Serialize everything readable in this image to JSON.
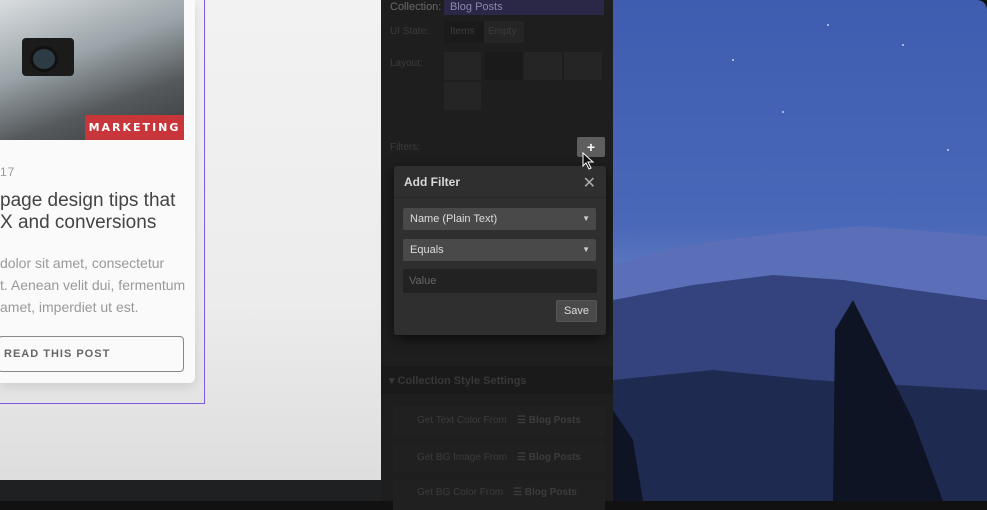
{
  "card": {
    "category": "MARKETING",
    "date": "17",
    "title_lines": [
      "page design tips that",
      "X and conversions"
    ],
    "excerpt_lines": [
      "dolor sit amet, consectetur",
      "t. Aenean velit dui, fermentum",
      "amet, imperdiet ut est."
    ],
    "button": "READ THIS POST"
  },
  "panel": {
    "collection_label": "Collection:",
    "collection_value": "Blog Posts",
    "ui_state_label": "UI State:",
    "ui_states": [
      "Items",
      "Empty"
    ],
    "layout_label": "Layout:",
    "filters_label": "Filters:",
    "style_section": "Collection Style Settings",
    "style_rows": [
      {
        "label": "Get Text Color From",
        "source": "Blog Posts"
      },
      {
        "label": "Get BG Image From",
        "source": "Blog Posts"
      },
      {
        "label": "Get BG Color From",
        "source": "Blog Posts"
      }
    ]
  },
  "popup": {
    "title": "Add Filter",
    "field": "Name (Plain Text)",
    "operator": "Equals",
    "value_placeholder": "Value",
    "save": "Save"
  },
  "colors": {
    "accent": "#7b5ce0",
    "badge": "#c8353a"
  }
}
